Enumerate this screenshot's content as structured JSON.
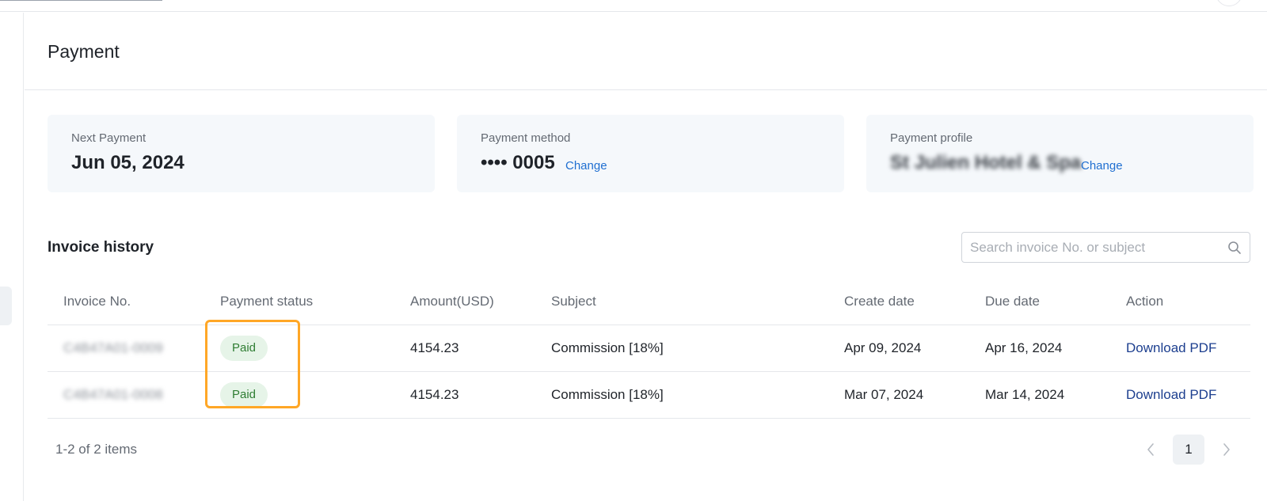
{
  "page": {
    "title": "Payment"
  },
  "cards": {
    "next_payment": {
      "label": "Next Payment",
      "value": "Jun 05, 2024"
    },
    "payment_method": {
      "label": "Payment method",
      "value": "•••• 0005",
      "change_label": "Change"
    },
    "payment_profile": {
      "label": "Payment profile",
      "value": "St Julien Hotel & Spa",
      "change_label": "Change"
    }
  },
  "invoice_history": {
    "title": "Invoice history",
    "search": {
      "placeholder": "Search invoice No. or subject",
      "icon": "search-icon"
    },
    "columns": [
      "Invoice No.",
      "Payment status",
      "Amount(USD)",
      "Subject",
      "Create date",
      "Due date",
      "Action"
    ],
    "rows": [
      {
        "invoice_no": "C4B47A01-0009",
        "status": "Paid",
        "amount": "4154.23",
        "subject": "Commission [18%]",
        "create_date": "Apr 09, 2024",
        "due_date": "Apr 16, 2024",
        "action": "Download PDF"
      },
      {
        "invoice_no": "C4B47A01-0008",
        "status": "Paid",
        "amount": "4154.23",
        "subject": "Commission [18%]",
        "create_date": "Mar 07, 2024",
        "due_date": "Mar 14, 2024",
        "action": "Download PDF"
      }
    ]
  },
  "pagination": {
    "summary": "1-2 of 2 items",
    "current_page": "1",
    "prev_icon": "chevron-left-icon",
    "next_icon": "chevron-right-icon"
  },
  "colors": {
    "accent_link": "#1f6fd1",
    "action_link": "#1d3f8f",
    "paid_badge_bg": "#e6f4e8",
    "paid_badge_text": "#2e7d32",
    "highlight": "#ffa726"
  }
}
